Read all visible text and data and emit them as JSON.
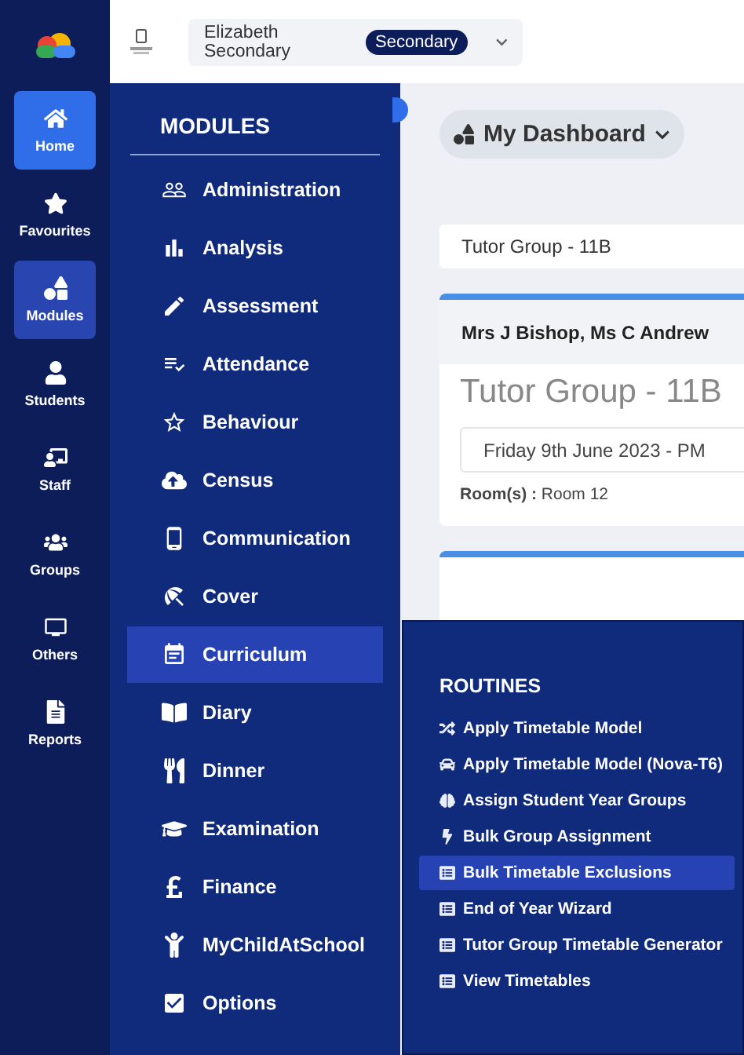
{
  "rail": [
    {
      "label": "Home",
      "selected": true,
      "open": false
    },
    {
      "label": "Favourites",
      "selected": false,
      "open": false
    },
    {
      "label": "Modules",
      "selected": false,
      "open": true
    },
    {
      "label": "Students",
      "selected": false,
      "open": false
    },
    {
      "label": "Staff",
      "selected": false,
      "open": false
    },
    {
      "label": "Groups",
      "selected": false,
      "open": false
    },
    {
      "label": "Others",
      "selected": false,
      "open": false
    },
    {
      "label": "Reports",
      "selected": false,
      "open": false
    }
  ],
  "header": {
    "school": "Elizabeth Secondary",
    "badge": "Secondary"
  },
  "modules": {
    "title": "MODULES",
    "items": [
      {
        "label": "Administration",
        "selected": false
      },
      {
        "label": "Analysis",
        "selected": false
      },
      {
        "label": "Assessment",
        "selected": false
      },
      {
        "label": "Attendance",
        "selected": false
      },
      {
        "label": "Behaviour",
        "selected": false
      },
      {
        "label": "Census",
        "selected": false
      },
      {
        "label": "Communication",
        "selected": false
      },
      {
        "label": "Cover",
        "selected": false
      },
      {
        "label": "Curriculum",
        "selected": true
      },
      {
        "label": "Diary",
        "selected": false
      },
      {
        "label": "Dinner",
        "selected": false
      },
      {
        "label": "Examination",
        "selected": false
      },
      {
        "label": "Finance",
        "selected": false
      },
      {
        "label": "MyChildAtSchool",
        "selected": false
      },
      {
        "label": "Options",
        "selected": false
      }
    ]
  },
  "dashboard": {
    "title": "My Dashboard",
    "group_field": "Tutor Group - 11B",
    "card": {
      "teachers": "Mrs J Bishop, Ms C Andrew",
      "group": "Tutor Group - 11B",
      "date": "Friday 9th June 2023 - PM",
      "room_label": "Room(s) :",
      "room": "Room 12"
    }
  },
  "routines": {
    "title": "ROUTINES",
    "items": [
      {
        "label": "Apply Timetable Model",
        "selected": false
      },
      {
        "label": "Apply Timetable Model (Nova-T6)",
        "selected": false
      },
      {
        "label": "Assign Student Year Groups",
        "selected": false
      },
      {
        "label": "Bulk Group Assignment",
        "selected": false
      },
      {
        "label": "Bulk Timetable Exclusions",
        "selected": true
      },
      {
        "label": "End of Year Wizard",
        "selected": false
      },
      {
        "label": "Tutor Group Timetable Generator",
        "selected": false
      },
      {
        "label": "View Timetables",
        "selected": false
      }
    ]
  }
}
